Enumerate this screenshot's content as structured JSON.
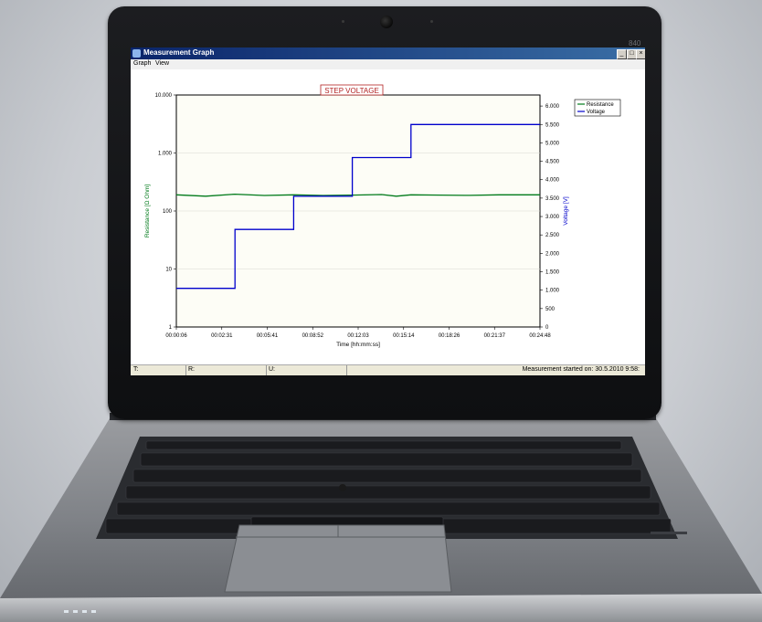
{
  "window": {
    "title": "Measurement Graph",
    "min_label": "_",
    "max_label": "□",
    "close_label": "×",
    "model": "840"
  },
  "menu": {
    "items": [
      "Graph",
      "View"
    ]
  },
  "chart_data": {
    "type": "line",
    "title": "STEP VOLTAGE",
    "xlabel": "Time  [hh:mm:ss]",
    "ylabel_left": "Resistance [Ω Ohm]",
    "ylabel_right": "Voltage [V]",
    "x_ticks": [
      "00:00:06",
      "00:02:31",
      "00:05:41",
      "00:08:52",
      "00:12:03",
      "00:15:14",
      "00:18:26",
      "00:21:37",
      "00:24:48"
    ],
    "left_ticks": [
      "10.000",
      "1.000",
      "100",
      "10",
      "1"
    ],
    "right_ticks": [
      "6.000",
      "5.500",
      "5.000",
      "4.500",
      "4.000",
      "3.500",
      "3.000",
      "2.500",
      "2.000",
      "1.500",
      "1.000",
      "500",
      "0"
    ],
    "left_scale": "log",
    "left_range": [
      1,
      10000
    ],
    "right_range": [
      0,
      6300
    ],
    "series": [
      {
        "name": "Resistance",
        "color": "#007a1a",
        "points": [
          [
            0,
            190
          ],
          [
            2,
            180
          ],
          [
            4,
            195
          ],
          [
            6,
            185
          ],
          [
            8,
            190
          ],
          [
            10,
            185
          ],
          [
            12,
            188
          ],
          [
            14,
            192
          ],
          [
            15,
            180
          ],
          [
            16,
            190
          ],
          [
            18,
            188
          ],
          [
            20,
            186
          ],
          [
            22,
            190
          ],
          [
            24.8,
            190
          ]
        ]
      },
      {
        "name": "Voltage",
        "color": "#0000cc",
        "points": [
          [
            0,
            1050
          ],
          [
            4,
            1050
          ],
          [
            4,
            2650
          ],
          [
            8,
            2650
          ],
          [
            8,
            3550
          ],
          [
            12,
            3550
          ],
          [
            12,
            4600
          ],
          [
            16,
            4600
          ],
          [
            16,
            5500
          ],
          [
            20,
            5500
          ],
          [
            20,
            5500
          ],
          [
            24.8,
            5500
          ]
        ]
      }
    ],
    "legend_position": "top-right",
    "grid": true
  },
  "status": {
    "t_label": "T:",
    "r_label": "R:",
    "u_label": "U:",
    "started_text": "Measurement started on:  30.5.2010 9:58:"
  }
}
